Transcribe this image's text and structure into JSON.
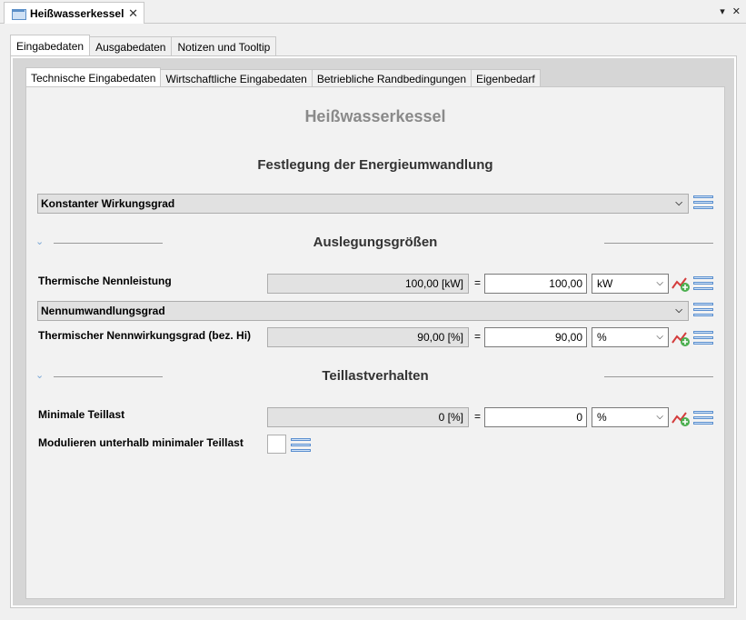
{
  "editor": {
    "tab_title": "Heißwasserkessel",
    "close_symbol": "✕",
    "menu_symbol": "▾",
    "close_view_symbol": "✕"
  },
  "main_tabs": [
    "Eingabedaten",
    "Ausgabedaten",
    "Notizen und Tooltip"
  ],
  "sub_tabs": [
    "Technische Eingabedaten",
    "Wirtschaftliche Eingabedaten",
    "Betriebliche Randbedingungen",
    "Eigenbedarf"
  ],
  "panel": {
    "title": "Heißwasserkessel",
    "section_energy": "Festlegung der Energieumwandlung",
    "energy_mode": "Konstanter Wirkungsgrad",
    "section_design": "Auslegungsgrößen",
    "section_partload": "Teillastverhalten"
  },
  "rows": {
    "thermal_power": {
      "label": "Thermische Nennleistung",
      "readonly": "100,00 [kW]",
      "eq": "=",
      "value": "100,00",
      "unit": "kW"
    },
    "conversion_mode": "Nennumwandlungsgrad",
    "efficiency": {
      "label": "Thermischer Nennwirkungsgrad (bez. Hi)",
      "readonly": "90,00 [%]",
      "eq": "=",
      "value": "90,00",
      "unit": "%"
    },
    "min_partload": {
      "label": "Minimale Teillast",
      "readonly": "0 [%]",
      "eq": "=",
      "value": "0",
      "unit": "%"
    },
    "modulate": {
      "label": "Modulieren unterhalb minimaler Teillast"
    }
  },
  "icons": {
    "list": "list-icon",
    "chart": "line-chart-add-icon",
    "chevron": "chevron-down-icon"
  }
}
